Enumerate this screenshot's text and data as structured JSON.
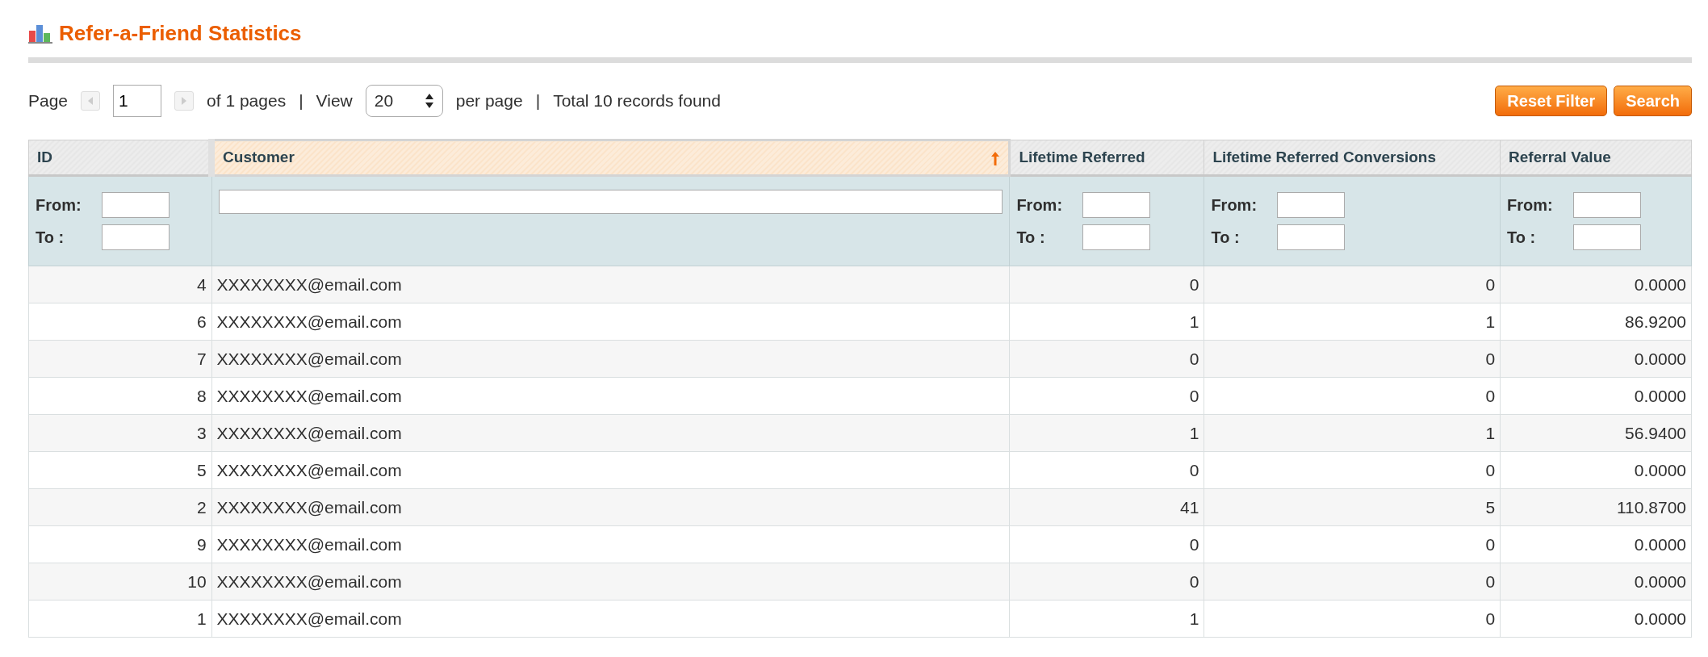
{
  "title": "Refer-a-Friend Statistics",
  "pager": {
    "page_label": "Page",
    "page": "1",
    "of_pages": "of 1 pages",
    "view_label": "View",
    "per_page": "20",
    "per_page_label": "per page",
    "total": "Total 10 records found",
    "separators": [
      "|",
      "|"
    ]
  },
  "buttons": [
    "Reset Filter",
    "Search"
  ],
  "columns": [
    {
      "label": "ID",
      "sorted": false,
      "filter": {
        "kind": "range",
        "from_label": "From:",
        "to_label": "To :"
      }
    },
    {
      "label": "Customer",
      "sorted": true,
      "filter": {
        "kind": "text"
      }
    },
    {
      "label": "Lifetime Referred",
      "sorted": false,
      "filter": {
        "kind": "range",
        "from_label": "From:",
        "to_label": "To :"
      }
    },
    {
      "label": "Lifetime Referred Conversions",
      "sorted": false,
      "filter": {
        "kind": "range",
        "from_label": "From:",
        "to_label": "To :"
      }
    },
    {
      "label": "Referral Value",
      "sorted": false,
      "filter": {
        "kind": "range",
        "from_label": "From:",
        "to_label": "To :"
      }
    }
  ],
  "rows": [
    [
      "4",
      "XXXXXXXX@email.com",
      "0",
      "0",
      "0.0000"
    ],
    [
      "6",
      "XXXXXXXX@email.com",
      "1",
      "1",
      "86.9200"
    ],
    [
      "7",
      "XXXXXXXX@email.com",
      "0",
      "0",
      "0.0000"
    ],
    [
      "8",
      "XXXXXXXX@email.com",
      "0",
      "0",
      "0.0000"
    ],
    [
      "3",
      "XXXXXXXX@email.com",
      "1",
      "1",
      "56.9400"
    ],
    [
      "5",
      "XXXXXXXX@email.com",
      "0",
      "0",
      "0.0000"
    ],
    [
      "2",
      "XXXXXXXX@email.com",
      "41",
      "5",
      "110.8700"
    ],
    [
      "9",
      "XXXXXXXX@email.com",
      "0",
      "0",
      "0.0000"
    ],
    [
      "10",
      "XXXXXXXX@email.com",
      "0",
      "0",
      "0.0000"
    ],
    [
      "1",
      "XXXXXXXX@email.com",
      "1",
      "0",
      "0.0000"
    ]
  ]
}
